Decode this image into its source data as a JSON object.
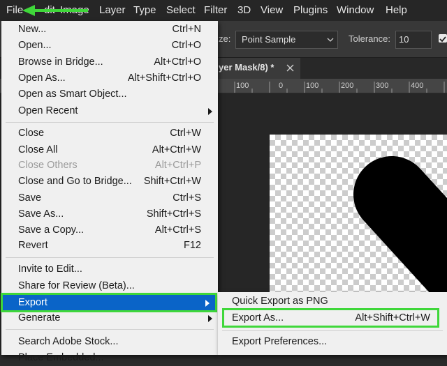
{
  "menubar": {
    "items": [
      "File",
      "Edit",
      "Image",
      "Layer",
      "Type",
      "Select",
      "Filter",
      "3D",
      "View",
      "Plugins",
      "Window",
      "Help"
    ],
    "visible": {
      "file": "File",
      "edit": "dit",
      "image": "Image",
      "layer": "Layer",
      "type": "Type",
      "select": "Select",
      "filter": "Filter",
      "3d": "3D",
      "view": "View",
      "plugins": "Plugins",
      "window": "Window",
      "help": "Help"
    }
  },
  "options": {
    "size_label": "ze:",
    "sample_value": "Point Sample",
    "tolerance_label": "Tolerance:",
    "tolerance_value": "10"
  },
  "doc_tab": {
    "title": "yer Mask/8) *"
  },
  "ruler": {
    "ticks": [
      "100",
      "0",
      "100",
      "200",
      "300",
      "400"
    ]
  },
  "file_menu": {
    "items": [
      {
        "label": "New...",
        "shortcut": "Ctrl+N"
      },
      {
        "label": "Open...",
        "shortcut": "Ctrl+O"
      },
      {
        "label": "Browse in Bridge...",
        "shortcut": "Alt+Ctrl+O"
      },
      {
        "label": "Open As...",
        "shortcut": "Alt+Shift+Ctrl+O"
      },
      {
        "label": "Open as Smart Object...",
        "shortcut": ""
      },
      {
        "label": "Open Recent",
        "shortcut": ""
      },
      {
        "label": "Close",
        "shortcut": "Ctrl+W"
      },
      {
        "label": "Close All",
        "shortcut": "Alt+Ctrl+W"
      },
      {
        "label": "Close Others",
        "shortcut": "Alt+Ctrl+P"
      },
      {
        "label": "Close and Go to Bridge...",
        "shortcut": "Shift+Ctrl+W"
      },
      {
        "label": "Save",
        "shortcut": "Ctrl+S"
      },
      {
        "label": "Save As...",
        "shortcut": "Shift+Ctrl+S"
      },
      {
        "label": "Save a Copy...",
        "shortcut": "Alt+Ctrl+S"
      },
      {
        "label": "Revert",
        "shortcut": "F12"
      },
      {
        "label": "Invite to Edit...",
        "shortcut": ""
      },
      {
        "label": "Share for Review (Beta)...",
        "shortcut": ""
      },
      {
        "label": "Export",
        "shortcut": ""
      },
      {
        "label": "Generate",
        "shortcut": ""
      },
      {
        "label": "Search Adobe Stock...",
        "shortcut": ""
      },
      {
        "label": "Place Embedded...",
        "shortcut": ""
      }
    ]
  },
  "export_menu": {
    "items": [
      {
        "label": "Quick Export as PNG",
        "shortcut": ""
      },
      {
        "label": "Export As...",
        "shortcut": "Alt+Shift+Ctrl+W"
      },
      {
        "label": "Export Preferences...",
        "shortcut": ""
      }
    ]
  },
  "colors": {
    "highlight": "#0a64c8",
    "annotation": "#3fd73a",
    "menu_bg": "#f0f0f0"
  }
}
